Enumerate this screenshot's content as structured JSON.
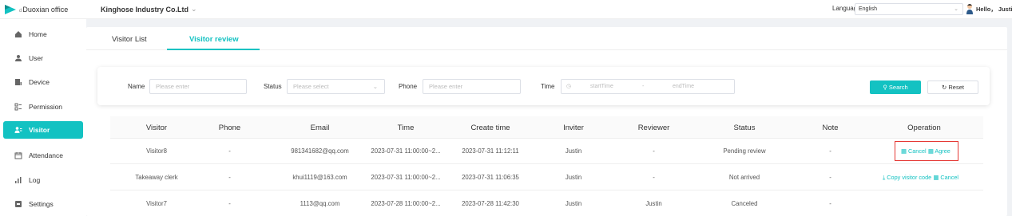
{
  "app": {
    "logo_prefix": "d",
    "logo_name": "Duoxian office",
    "company": "Kinghose Industry Co.Ltd",
    "language_label": "Language",
    "language_value": "English",
    "greeting": "Hello， Justin",
    "accent_color": "#13c2c2"
  },
  "sidebar": {
    "items": [
      {
        "label": "Home",
        "icon": "home-icon"
      },
      {
        "label": "User",
        "icon": "user-icon"
      },
      {
        "label": "Device",
        "icon": "device-icon"
      },
      {
        "label": "Permission",
        "icon": "permission-icon"
      },
      {
        "label": "Visitor",
        "icon": "visitor-icon",
        "active": true
      },
      {
        "label": "Attendance",
        "icon": "calendar-icon"
      },
      {
        "label": "Log",
        "icon": "log-icon"
      },
      {
        "label": "Settings",
        "icon": "settings-icon"
      }
    ]
  },
  "tabs": [
    {
      "label": "Visitor List",
      "active": false
    },
    {
      "label": "Visitor review",
      "active": true
    }
  ],
  "filter": {
    "name_label": "Name",
    "name_placeholder": "Please enter",
    "status_label": "Status",
    "status_placeholder": "Please select",
    "phone_label": "Phone",
    "phone_placeholder": "Please enter",
    "time_label": "Time",
    "start_placeholder": "startTime",
    "separator": "-",
    "end_placeholder": "endTime",
    "search_label": "Search",
    "reset_label": "Reset"
  },
  "table": {
    "columns": [
      "Visitor",
      "Phone",
      "Email",
      "Time",
      "Create time",
      "Inviter",
      "Reviewer",
      "Status",
      "Note",
      "Operation"
    ],
    "rows": [
      {
        "visitor": "Visitor8",
        "phone": "-",
        "email": "981341682@qq.com",
        "time": "2023-07-31 11:00:00~2...",
        "create_time": "2023-07-31 11:12:11",
        "inviter": "Justin",
        "reviewer": "-",
        "status": "Pending review",
        "note": "-",
        "ops": [
          "Cancel",
          "Agree"
        ]
      },
      {
        "visitor": "Takeaway clerk",
        "phone": "-",
        "email": "khui1119@163.com",
        "time": "2023-07-31 11:00:00~2...",
        "create_time": "2023-07-31 11:06:35",
        "inviter": "Justin",
        "reviewer": "-",
        "status": "Not arrived",
        "note": "-",
        "ops": [
          "Copy visitor code",
          "Cancel"
        ]
      },
      {
        "visitor": "Visitor7",
        "phone": "-",
        "email": "1113@qq.com",
        "time": "2023-07-28 11:00:00~2...",
        "create_time": "2023-07-28 11:42:30",
        "inviter": "Justin",
        "reviewer": "Justin",
        "status": "Canceled",
        "note": "-",
        "ops": []
      }
    ]
  }
}
